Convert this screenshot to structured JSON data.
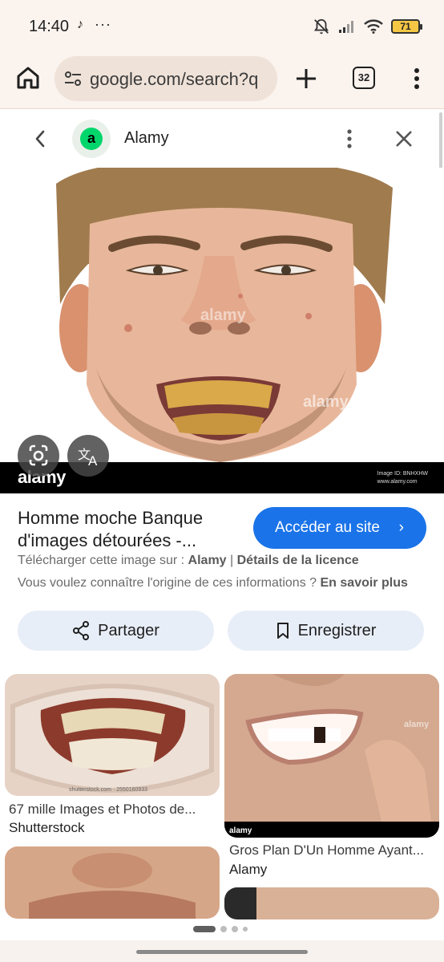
{
  "status": {
    "time": "14:40",
    "battery": "71"
  },
  "browser": {
    "url": "google.com/search?q",
    "tab_count": "32"
  },
  "panel": {
    "site_name": "Alamy",
    "favicon_letter": "a"
  },
  "image": {
    "watermark_brand": "alamy",
    "watermark_id": "Image ID: BNHXHW",
    "watermark_url": "www.alamy.com"
  },
  "result": {
    "title_line1": "Homme moche Banque",
    "title_line2": "d'images détourées -...",
    "visit_label": "Accéder au site",
    "download_prefix": "Télécharger cette image sur : ",
    "download_site": "Alamy",
    "download_sep": " | ",
    "license_link": "Détails de la licence",
    "origin_question": "Vous voulez connaître l'origine de ces informations ? ",
    "learn_more": "En savoir plus"
  },
  "actions": {
    "share_label": "Partager",
    "save_label": "Enregistrer"
  },
  "related": [
    {
      "caption": "67 mille Images et Photos de...",
      "source": "Shutterstock",
      "watermark": "shutterstock.com · 2550160933"
    },
    {
      "caption": "Gros Plan D'Un Homme Ayant...",
      "source": "Alamy",
      "watermark": "alamy"
    }
  ],
  "icons": {
    "home": "home-icon",
    "site_info": "tune-icon",
    "new_tab": "plus-icon",
    "tabs": "tab-switcher-icon",
    "menu": "more-vert-icon",
    "back": "chevron-left-icon",
    "close": "close-icon",
    "lens": "google-lens-icon",
    "translate": "translate-icon",
    "share": "share-icon",
    "save": "bookmark-icon"
  },
  "colors": {
    "accent": "#1a73e8",
    "chrome_bg": "#fbf3ee",
    "action_bg": "#e8eef8"
  }
}
